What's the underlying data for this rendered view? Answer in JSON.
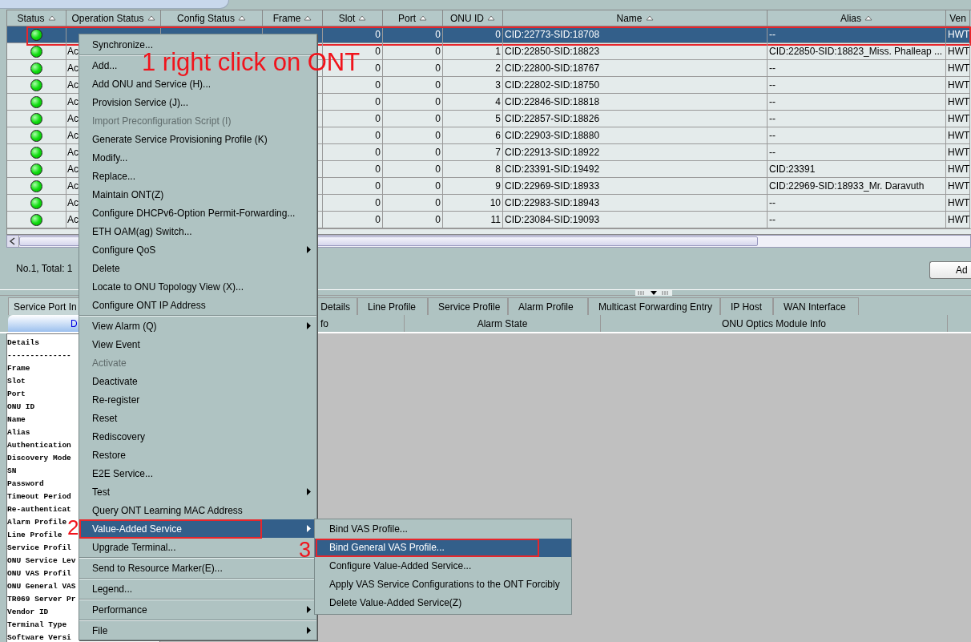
{
  "table": {
    "columns": [
      "Status",
      "Operation Status",
      "Config Status",
      "Frame",
      "Slot",
      "Port",
      "ONU ID",
      "Name",
      "Alias",
      "Ven"
    ],
    "rows": [
      {
        "online": true,
        "selected": true,
        "annotated": true,
        "slot": "0",
        "port": "0",
        "onu_id": "0",
        "name": "CID:22773-SID:18708",
        "alias": "--",
        "vendor": "HWT"
      },
      {
        "online": true,
        "selected": false,
        "annotated": false,
        "operation_status": "Ac",
        "slot": "0",
        "port": "0",
        "onu_id": "1",
        "name": "CID:22850-SID:18823",
        "alias": "CID:22850-SID:18823_Miss. Phalleap ...",
        "vendor": "HWT"
      },
      {
        "online": true,
        "selected": false,
        "annotated": false,
        "operation_status": "Ac",
        "slot": "0",
        "port": "0",
        "onu_id": "2",
        "name": "CID:22800-SID:18767",
        "alias": "--",
        "vendor": "HWT"
      },
      {
        "online": true,
        "selected": false,
        "annotated": false,
        "operation_status": "Ac",
        "slot": "0",
        "port": "0",
        "onu_id": "3",
        "name": "CID:22802-SID:18750",
        "alias": "--",
        "vendor": "HWT"
      },
      {
        "online": true,
        "selected": false,
        "annotated": false,
        "operation_status": "Ac",
        "slot": "0",
        "port": "0",
        "onu_id": "4",
        "name": "CID:22846-SID:18818",
        "alias": "--",
        "vendor": "HWT"
      },
      {
        "online": true,
        "selected": false,
        "annotated": false,
        "operation_status": "Ac",
        "slot": "0",
        "port": "0",
        "onu_id": "5",
        "name": "CID:22857-SID:18826",
        "alias": "--",
        "vendor": "HWT"
      },
      {
        "online": true,
        "selected": false,
        "annotated": false,
        "operation_status": "Ac",
        "slot": "0",
        "port": "0",
        "onu_id": "6",
        "name": "CID:22903-SID:18880",
        "alias": "--",
        "vendor": "HWT"
      },
      {
        "online": true,
        "selected": false,
        "annotated": false,
        "operation_status": "Ac",
        "slot": "0",
        "port": "0",
        "onu_id": "7",
        "name": "CID:22913-SID:18922",
        "alias": "--",
        "vendor": "HWT"
      },
      {
        "online": true,
        "selected": false,
        "annotated": false,
        "operation_status": "Ac",
        "slot": "0",
        "port": "0",
        "onu_id": "8",
        "name": "CID:23391-SID:19492",
        "alias": "CID:23391",
        "vendor": "HWT"
      },
      {
        "online": true,
        "selected": false,
        "annotated": false,
        "operation_status": "Ac",
        "slot": "0",
        "port": "0",
        "onu_id": "9",
        "name": "CID:22969-SID:18933",
        "alias": "CID:22969-SID:18933_Mr. Daravuth",
        "vendor": "HWT"
      },
      {
        "online": true,
        "selected": false,
        "annotated": false,
        "operation_status": "Ac",
        "slot": "0",
        "port": "0",
        "onu_id": "10",
        "name": "CID:22983-SID:18943",
        "alias": "--",
        "vendor": "HWT"
      },
      {
        "online": true,
        "selected": false,
        "annotated": false,
        "operation_status": "Ac",
        "slot": "0",
        "port": "0",
        "onu_id": "11",
        "name": "CID:23084-SID:19093",
        "alias": "--",
        "vendor": "HWT"
      }
    ]
  },
  "summary": "No.1, Total: 1",
  "add_button": "Ad",
  "detail_tabs": [
    {
      "label": "Service Port In",
      "selected": true
    },
    {
      "label": "Details",
      "selected": false
    },
    {
      "label": "Line Profile",
      "selected": false
    },
    {
      "label": "Service Profile",
      "selected": false
    },
    {
      "label": "Alarm Profile",
      "selected": false
    },
    {
      "label": "Multicast Forwarding Entry",
      "selected": false
    },
    {
      "label": "IP Host",
      "selected": false
    },
    {
      "label": "WAN Interface",
      "selected": false
    }
  ],
  "sub_header": [
    {
      "label": "D",
      "selected": true
    },
    {
      "label": "fo",
      "selected": false
    },
    {
      "label": "Alarm State",
      "selected": false
    },
    {
      "label": "ONU Optics Module Info",
      "selected": false
    }
  ],
  "details_lines": [
    "Details",
    "--------------",
    "Frame",
    "Slot",
    "Port",
    "ONU ID",
    "Name",
    "Alias",
    "Authentication",
    "Discovery Mode",
    "SN",
    "Password",
    "Timeout Period",
    "Re-authenticat",
    "Alarm Profile",
    "Line Profile",
    "Service Profil",
    "ONU Service Lev",
    "ONU VAS Profil",
    "ONU General VAS",
    "TR069 Server Pr",
    "Vendor ID",
    "Terminal Type",
    "Software Versi"
  ],
  "context_menu": [
    {
      "kind": "item",
      "label": "Synchronize...",
      "disabled": false,
      "selected": false,
      "annotated": false
    },
    {
      "kind": "separator"
    },
    {
      "kind": "item",
      "label": "Add...",
      "disabled": false,
      "selected": false,
      "annotated": false
    },
    {
      "kind": "item",
      "label": "Add ONU and Service (H)...",
      "disabled": false,
      "selected": false,
      "annotated": false
    },
    {
      "kind": "item",
      "label": "Provision Service (J)...",
      "disabled": false,
      "selected": false,
      "annotated": false
    },
    {
      "kind": "item",
      "label": "Import Preconfiguration Script (I)",
      "disabled": true,
      "selected": false,
      "annotated": false
    },
    {
      "kind": "item",
      "label": "Generate Service Provisioning Profile (K)",
      "disabled": false,
      "selected": false,
      "annotated": false
    },
    {
      "kind": "item",
      "label": "Modify...",
      "disabled": false,
      "selected": false,
      "annotated": false
    },
    {
      "kind": "item",
      "label": "Replace...",
      "disabled": false,
      "selected": false,
      "annotated": false
    },
    {
      "kind": "item",
      "label": "Maintain ONT(Z)",
      "disabled": false,
      "selected": false,
      "annotated": false
    },
    {
      "kind": "item",
      "label": "Configure DHCPv6-Option Permit-Forwarding...",
      "disabled": false,
      "selected": false,
      "annotated": false
    },
    {
      "kind": "item",
      "label": "ETH OAM(ag) Switch...",
      "disabled": false,
      "selected": false,
      "annotated": false
    },
    {
      "kind": "submenu",
      "label": "Configure QoS",
      "disabled": false,
      "selected": false,
      "annotated": false
    },
    {
      "kind": "item",
      "label": "Delete",
      "disabled": false,
      "selected": false,
      "annotated": false
    },
    {
      "kind": "item",
      "label": "Locate to ONU Topology View (X)...",
      "disabled": false,
      "selected": false,
      "annotated": false
    },
    {
      "kind": "item",
      "label": "Configure ONT IP Address",
      "disabled": false,
      "selected": false,
      "annotated": false
    },
    {
      "kind": "separator"
    },
    {
      "kind": "submenu",
      "label": "View Alarm (Q)",
      "disabled": false,
      "selected": false,
      "annotated": false
    },
    {
      "kind": "item",
      "label": "View Event",
      "disabled": false,
      "selected": false,
      "annotated": false
    },
    {
      "kind": "item",
      "label": "Activate",
      "disabled": true,
      "selected": false,
      "annotated": false
    },
    {
      "kind": "item",
      "label": "Deactivate",
      "disabled": false,
      "selected": false,
      "annotated": false
    },
    {
      "kind": "item",
      "label": "Re-register",
      "disabled": false,
      "selected": false,
      "annotated": false
    },
    {
      "kind": "item",
      "label": "Reset",
      "disabled": false,
      "selected": false,
      "annotated": false
    },
    {
      "kind": "item",
      "label": "Rediscovery",
      "disabled": false,
      "selected": false,
      "annotated": false
    },
    {
      "kind": "item",
      "label": "Restore",
      "disabled": false,
      "selected": false,
      "annotated": false
    },
    {
      "kind": "item",
      "label": "E2E Service...",
      "disabled": false,
      "selected": false,
      "annotated": false
    },
    {
      "kind": "submenu",
      "label": "Test",
      "disabled": false,
      "selected": false,
      "annotated": false
    },
    {
      "kind": "item",
      "label": "Query ONT Learning MAC Address",
      "disabled": false,
      "selected": false,
      "annotated": false
    },
    {
      "kind": "submenu",
      "label": "Value-Added Service",
      "disabled": false,
      "selected": true,
      "annotated": true
    },
    {
      "kind": "item",
      "label": "Upgrade Terminal...",
      "disabled": false,
      "selected": false,
      "annotated": false
    },
    {
      "kind": "separator"
    },
    {
      "kind": "item",
      "label": "Send to Resource Marker(E)...",
      "disabled": false,
      "selected": false,
      "annotated": false
    },
    {
      "kind": "separator"
    },
    {
      "kind": "item",
      "label": "Legend...",
      "disabled": false,
      "selected": false,
      "annotated": false
    },
    {
      "kind": "separator"
    },
    {
      "kind": "submenu",
      "label": "Performance",
      "disabled": false,
      "selected": false,
      "annotated": false
    },
    {
      "kind": "separator"
    },
    {
      "kind": "submenu",
      "label": "File",
      "disabled": false,
      "selected": false,
      "annotated": false
    }
  ],
  "submenu": [
    {
      "label": "Bind VAS Profile...",
      "selected": false,
      "annotated": false
    },
    {
      "label": "Bind General VAS Profile...",
      "selected": true,
      "annotated": true
    },
    {
      "label": "Configure Value-Added Service...",
      "selected": false,
      "annotated": false
    },
    {
      "label": "Apply VAS Service Configurations to the ONT Forcibly",
      "selected": false,
      "annotated": false
    },
    {
      "label": "Delete Value-Added Service(Z)",
      "selected": false,
      "annotated": false
    }
  ],
  "annotations": [
    "1 right click on ONT",
    "2",
    "3"
  ]
}
